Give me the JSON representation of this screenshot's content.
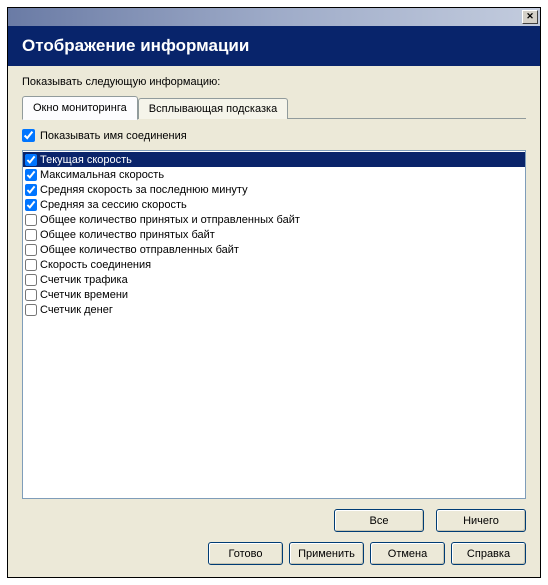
{
  "window": {
    "title": "Отображение информации",
    "instruction": "Показывать следующую информацию:"
  },
  "tabs": {
    "monitor": "Окно мониторинга",
    "tooltip": "Всплывающая подсказка"
  },
  "show_connection_name": "Показывать имя соединения",
  "items": [
    {
      "label": "Текущая скорость",
      "checked": true,
      "selected": true
    },
    {
      "label": "Максимальная скорость",
      "checked": true,
      "selected": false
    },
    {
      "label": "Средняя скорость за последнюю минуту",
      "checked": true,
      "selected": false
    },
    {
      "label": "Средняя за сессию скорость",
      "checked": true,
      "selected": false
    },
    {
      "label": "Общее количество принятых и отправленных байт",
      "checked": false,
      "selected": false
    },
    {
      "label": "Общее количество принятых байт",
      "checked": false,
      "selected": false
    },
    {
      "label": "Общее количество отправленных байт",
      "checked": false,
      "selected": false
    },
    {
      "label": "Скорость соединения",
      "checked": false,
      "selected": false
    },
    {
      "label": "Счетчик трафика",
      "checked": false,
      "selected": false
    },
    {
      "label": "Счетчик времени",
      "checked": false,
      "selected": false
    },
    {
      "label": "Счетчик денег",
      "checked": false,
      "selected": false
    }
  ],
  "buttons": {
    "all": "Все",
    "none": "Ничего",
    "done": "Готово",
    "apply": "Применить",
    "cancel": "Отмена",
    "help": "Справка"
  }
}
